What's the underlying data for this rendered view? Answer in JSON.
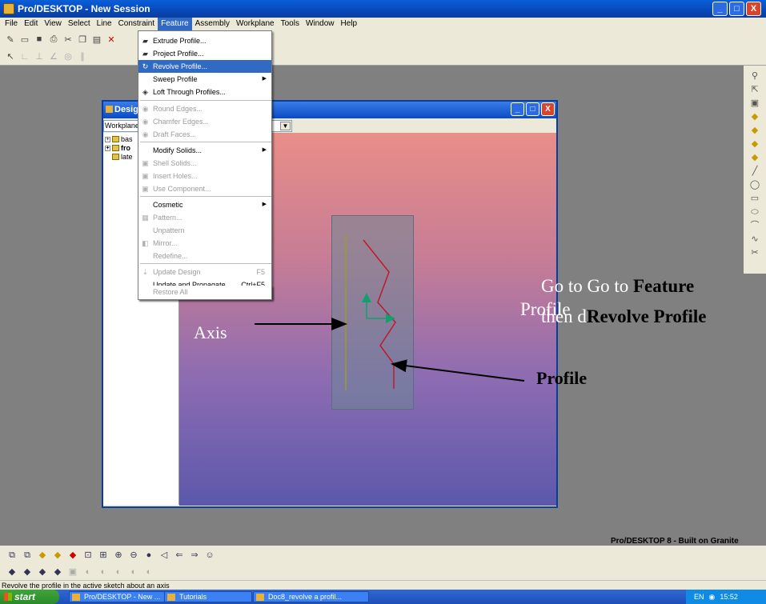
{
  "window": {
    "title": "Pro/DESKTOP - New Session",
    "min": "_",
    "max": "□",
    "close": "X"
  },
  "menubar": [
    "File",
    "Edit",
    "View",
    "Select",
    "Line",
    "Constraint",
    "Feature",
    "Assembly",
    "Workplane",
    "Tools",
    "Window",
    "Help"
  ],
  "feature_menu": {
    "items": [
      {
        "label": "Extrude Profile...",
        "state": "normal",
        "icon": "extrude-icon"
      },
      {
        "label": "Project Profile...",
        "state": "normal",
        "icon": "project-icon"
      },
      {
        "label": "Revolve Profile...",
        "state": "highlighted",
        "icon": "revolve-icon"
      },
      {
        "label": "Sweep Profile",
        "state": "normal",
        "submenu": true
      },
      {
        "label": "Loft Through Profiles...",
        "state": "normal",
        "icon": "loft-icon"
      },
      {
        "label": "Round Edges...",
        "state": "disabled"
      },
      {
        "label": "Chamfer Edges...",
        "state": "disabled"
      },
      {
        "label": "Draft Faces...",
        "state": "disabled"
      },
      {
        "label": "Modify Solids...",
        "state": "normal",
        "submenu": true
      },
      {
        "label": "Shell Solids...",
        "state": "disabled"
      },
      {
        "label": "Insert Holes...",
        "state": "disabled"
      },
      {
        "label": "Use Component...",
        "state": "disabled"
      },
      {
        "label": "Cosmetic",
        "state": "normal",
        "submenu": true
      },
      {
        "label": "Pattern...",
        "state": "disabled"
      },
      {
        "label": "Unpattern",
        "state": "disabled"
      },
      {
        "label": "Mirror...",
        "state": "disabled"
      },
      {
        "label": "Redefine...",
        "state": "disabled"
      },
      {
        "label": "Update Design",
        "state": "disabled",
        "shortcut": "F5"
      },
      {
        "label": "Update and Propagate",
        "state": "normal",
        "shortcut": "Ctrl+F5"
      },
      {
        "label": "Restore All",
        "state": "disabled"
      }
    ]
  },
  "design_window": {
    "title": "Design",
    "workplane_combo": "Workplane",
    "tree": [
      {
        "label": "bas",
        "expand": "+"
      },
      {
        "label": "fro",
        "expand": "+"
      },
      {
        "label": "late",
        "expand": ""
      }
    ]
  },
  "annotations": {
    "axis": "Axis",
    "profile": "Profile",
    "instr_line1": "Go to Go to ",
    "instr_feature": "Feature",
    "instr_overlap": "Profile",
    "instr_then": "then d",
    "instr_revolve": "Revolve Profile"
  },
  "brand": "Pro/DESKTOP 8 - Built on Granite",
  "status": "Revolve the profile in the active sketch about an axis",
  "taskbar": {
    "start": "start",
    "tasks": [
      "Pro/DESKTOP - New ...",
      "Tutorials",
      "Doc8_revolve a profil..."
    ],
    "tray_lang": "EN",
    "tray_time": "15:52"
  },
  "colors": {
    "titlebar": "#0A4BC4",
    "menu_highlight": "#316AC5",
    "profile_line": "#C0182C",
    "axis_line": "#9B9A2C",
    "arrow_green": "#10A070"
  }
}
